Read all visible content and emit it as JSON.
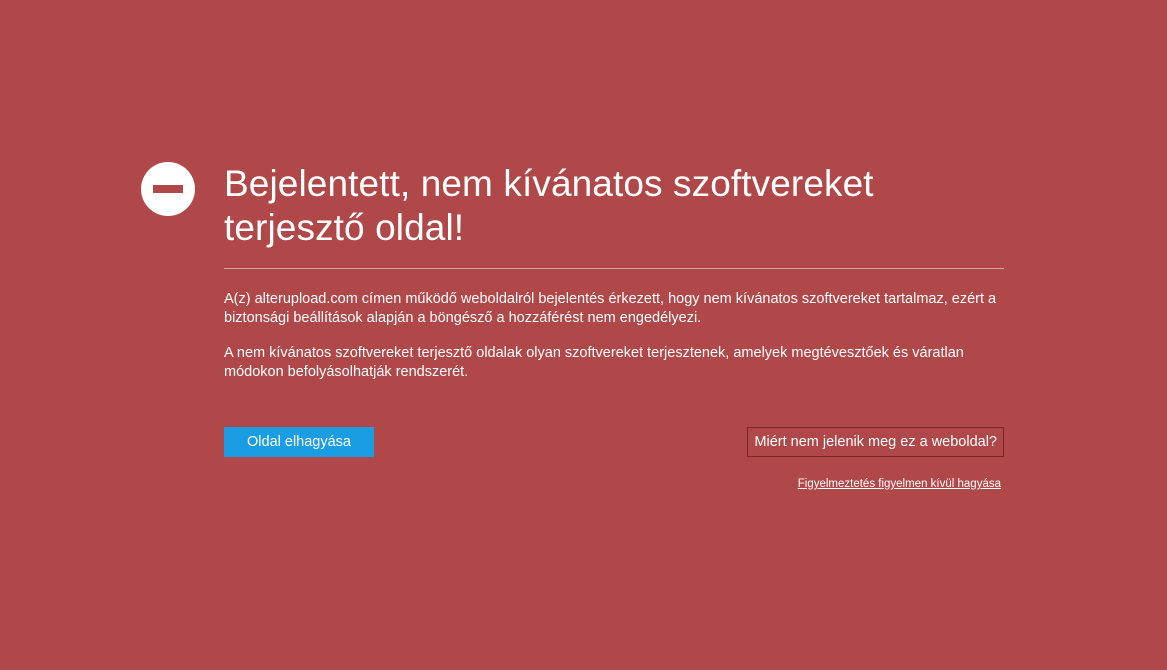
{
  "icon": "block-icon",
  "colors": {
    "background": "#b04849",
    "primary_button": "#1a9de3",
    "text": "#ffffff"
  },
  "title": "Bejelentett, nem kívánatos szoftvereket terjesztő oldal!",
  "paragraph1": "A(z) alterupload.com címen működő weboldalról bejelentés érkezett, hogy nem kívánatos szoftvereket tartalmaz, ezért a biztonsági beállítások alapján a böngésző a hozzáférést nem engedélyezi.",
  "paragraph2": "A nem kívánatos szoftvereket terjesztő oldalak olyan szoftvereket terjesztenek, amelyek megtévesztőek és váratlan módokon befolyásolhatják rendszerét.",
  "buttons": {
    "leave": "Oldal elhagyása",
    "why": "Miért nem jelenik meg ez a weboldal?"
  },
  "ignore_link": "Figyelmeztetés figyelmen kívül hagyása"
}
